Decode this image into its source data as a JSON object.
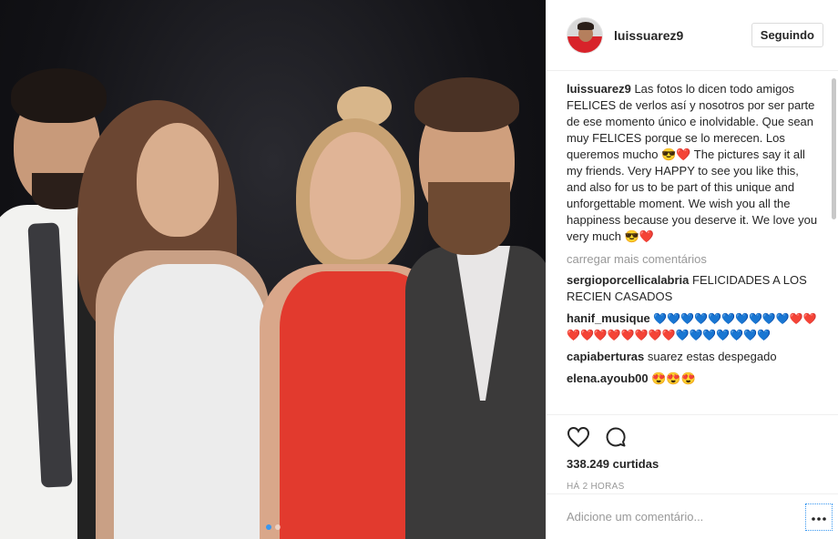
{
  "post": {
    "username": "luissuarez9",
    "follow_label": "Seguindo",
    "caption": "Las fotos lo dicen todo amigos FELICES de verlos así y nosotros por ser parte de ese momento único e inolvidable. Que sean muy FELICES porque se lo merecen. Los queremos mucho 😎❤️ The pictures say it all my friends. Very HAPPY to see you like this, and also for us to be part of this unique and unforgettable moment. We wish you all the happiness because you deserve it. We love you very much 😎❤️",
    "load_more": "carregar mais comentários",
    "comments": [
      {
        "user": "sergioporcellicalabria",
        "text": "FELICIDADES A LOS RECIEN CASADOS"
      },
      {
        "user": "hanif_musique",
        "text": "💙💙💙💙💙💙💙💙💙💙❤️❤️❤️❤️❤️❤️❤️❤️❤️❤️💙💙💙💙💙💙💙"
      },
      {
        "user": "capiaberturas",
        "text": "suarez estas despegado"
      },
      {
        "user": "elena.ayoub00",
        "text": "😍😍😍"
      }
    ],
    "likes": "338.249 curtidas",
    "time": "HÁ 2 HORAS",
    "add_comment_placeholder": "Adicione um comentário..."
  },
  "icons": {
    "like": "heart-icon",
    "comment": "comment-icon",
    "more": "more-options-icon"
  },
  "colors": {
    "accent": "#3897f0",
    "dress_red": "#e23a2e"
  }
}
